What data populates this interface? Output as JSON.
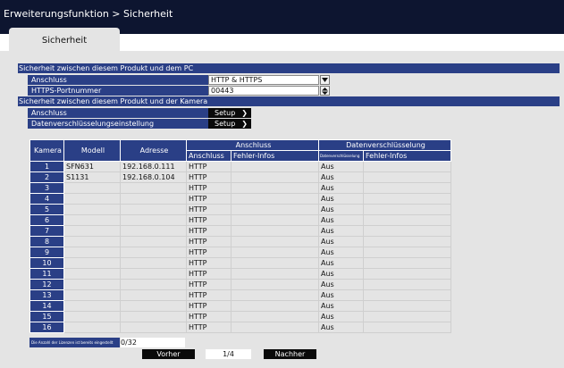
{
  "title": "Erweiterungsfunktion > Sicherheit",
  "tab": "Sicherheit",
  "pc_section": {
    "title": "Sicherheit zwischen diesem Produkt und dem PC",
    "connection_label": "Anschluss",
    "connection_value": "HTTP & HTTPS",
    "https_port_label": "HTTPS-Portnummer",
    "https_port_value": "00443"
  },
  "camera_section": {
    "title": "Sicherheit zwischen diesem Produkt und der Kamera",
    "connection_label": "Anschluss",
    "encryption_label": "Datenverschlüsselungseinstellung",
    "setup_label": "Setup",
    "arrow_icon": "chevron-right-icon"
  },
  "table": {
    "headers": {
      "camera": "Kamera",
      "model": "Modell",
      "address": "Adresse",
      "connection_group": "Anschluss",
      "encryption_group": "Datenverschlüsselung",
      "connection": "Anschluss",
      "error_info": "Fehler-Infos",
      "encryption": "Datenverschlüsselung",
      "encryption_error_info": "Fehler-Infos"
    },
    "rows": [
      {
        "num": "1",
        "model": "SFN631",
        "address": "192.168.0.111",
        "connection": "HTTP",
        "encryption": "Aus"
      },
      {
        "num": "2",
        "model": "S1131",
        "address": "192.168.0.104",
        "connection": "HTTP",
        "encryption": "Aus"
      },
      {
        "num": "3",
        "model": "",
        "address": "",
        "connection": "HTTP",
        "encryption": "Aus"
      },
      {
        "num": "4",
        "model": "",
        "address": "",
        "connection": "HTTP",
        "encryption": "Aus"
      },
      {
        "num": "5",
        "model": "",
        "address": "",
        "connection": "HTTP",
        "encryption": "Aus"
      },
      {
        "num": "6",
        "model": "",
        "address": "",
        "connection": "HTTP",
        "encryption": "Aus"
      },
      {
        "num": "7",
        "model": "",
        "address": "",
        "connection": "HTTP",
        "encryption": "Aus"
      },
      {
        "num": "8",
        "model": "",
        "address": "",
        "connection": "HTTP",
        "encryption": "Aus"
      },
      {
        "num": "9",
        "model": "",
        "address": "",
        "connection": "HTTP",
        "encryption": "Aus"
      },
      {
        "num": "10",
        "model": "",
        "address": "",
        "connection": "HTTP",
        "encryption": "Aus"
      },
      {
        "num": "11",
        "model": "",
        "address": "",
        "connection": "HTTP",
        "encryption": "Aus"
      },
      {
        "num": "12",
        "model": "",
        "address": "",
        "connection": "HTTP",
        "encryption": "Aus"
      },
      {
        "num": "13",
        "model": "",
        "address": "",
        "connection": "HTTP",
        "encryption": "Aus"
      },
      {
        "num": "14",
        "model": "",
        "address": "",
        "connection": "HTTP",
        "encryption": "Aus"
      },
      {
        "num": "15",
        "model": "",
        "address": "",
        "connection": "HTTP",
        "encryption": "Aus"
      },
      {
        "num": "16",
        "model": "",
        "address": "",
        "connection": "HTTP",
        "encryption": "Aus"
      }
    ]
  },
  "footer": {
    "count_label": "Die Anzahl der Lizenzen ist bereits eingestellt",
    "count_value": "0/32",
    "prev_label": "Vorher",
    "page": "1/4",
    "next_label": "Nachher"
  },
  "colors": {
    "title_bar": "#0d1530",
    "header_blue": "#2a3f86",
    "panel": "#e4e4e4",
    "button": "#0a0a0a"
  }
}
